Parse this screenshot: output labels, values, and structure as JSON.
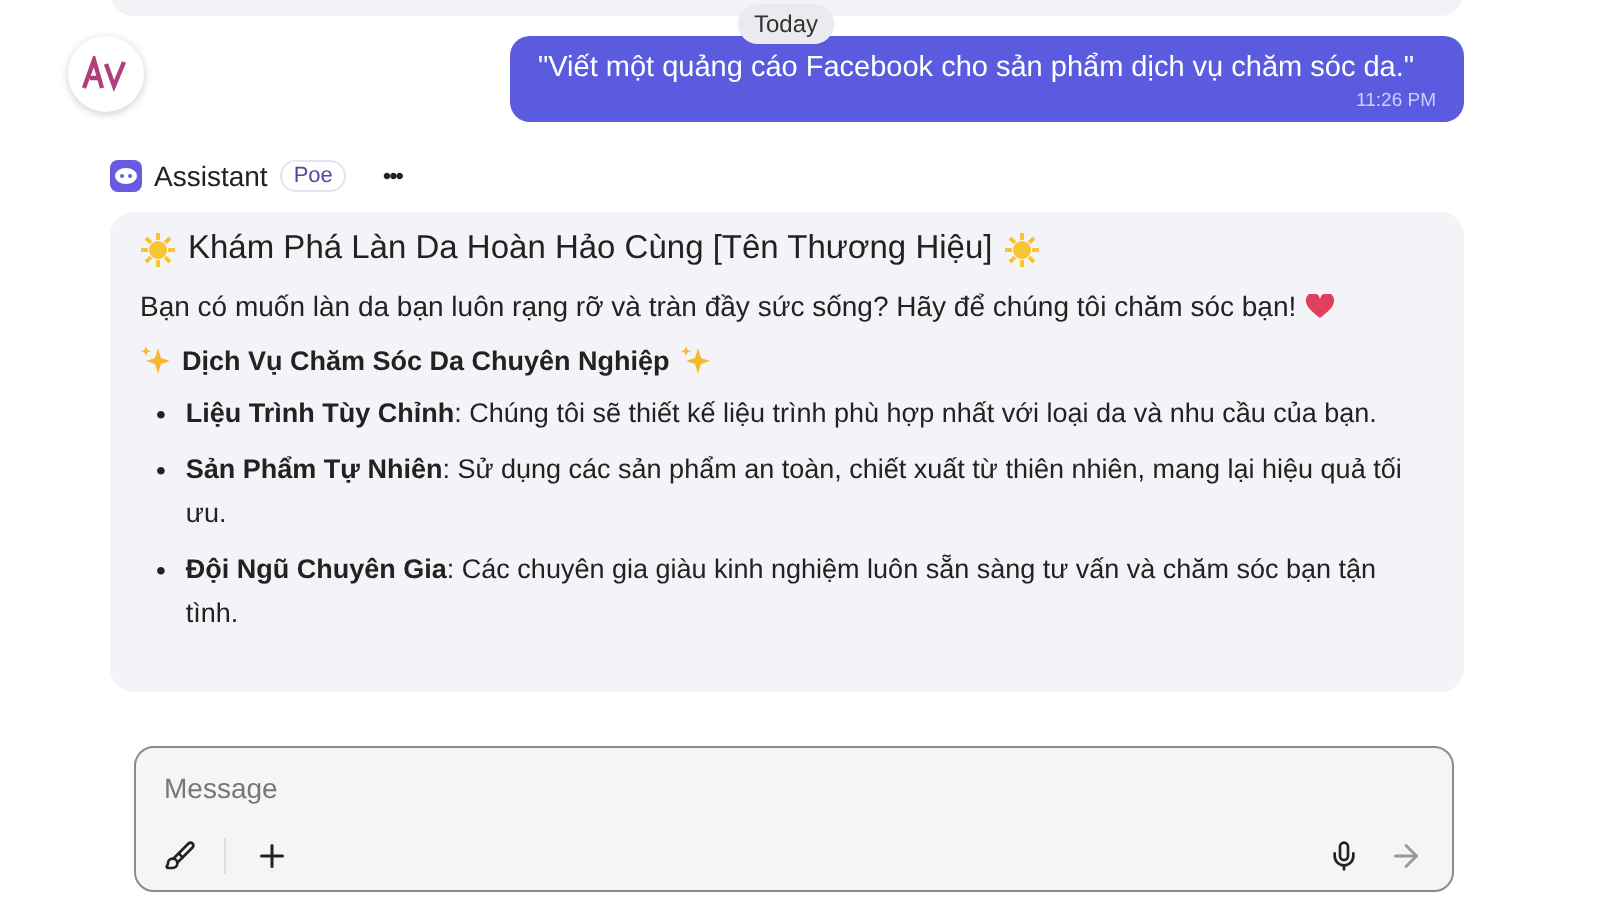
{
  "date_divider": "Today",
  "user_message": {
    "text": "\"Viết một quảng cáo Facebook cho sản phẩm dịch vụ chăm sóc da.\"",
    "time": "11:26 PM"
  },
  "bot": {
    "name": "Assistant",
    "badge": "Poe",
    "menu": "•••"
  },
  "reply": {
    "title": "Khám Phá Làn Da Hoàn Hảo Cùng [Tên Thương Hiệu]",
    "intro": "Bạn có muốn làn da bạn luôn rạng rỡ và tràn đầy sức sống? Hãy để chúng tôi chăm sóc bạn!",
    "section": "Dịch Vụ Chăm Sóc Da Chuyên Nghiệp",
    "bullets": [
      {
        "marker": "•",
        "text": "**Liệu Trình Tùy Chỉnh**: Chúng tôi sẽ thiết kế liệu trình phù hợp nhất với loại da và nhu cầu của bạn."
      },
      {
        "marker": "•",
        "text": "**Sản Phẩm Tự Nhiên**: Sử dụng các sản phẩm an toàn, chiết xuất từ thiên nhiên, mang lại hiệu quả tối ưu."
      },
      {
        "marker": "•",
        "text": "**Đội Ngũ Chuyên Gia**: Các chuyên gia giàu kinh nghiệm luôn sẵn sàng tư vấn và chăm sóc bạn tận tình."
      }
    ]
  },
  "composer": {
    "placeholder": "Message"
  }
}
